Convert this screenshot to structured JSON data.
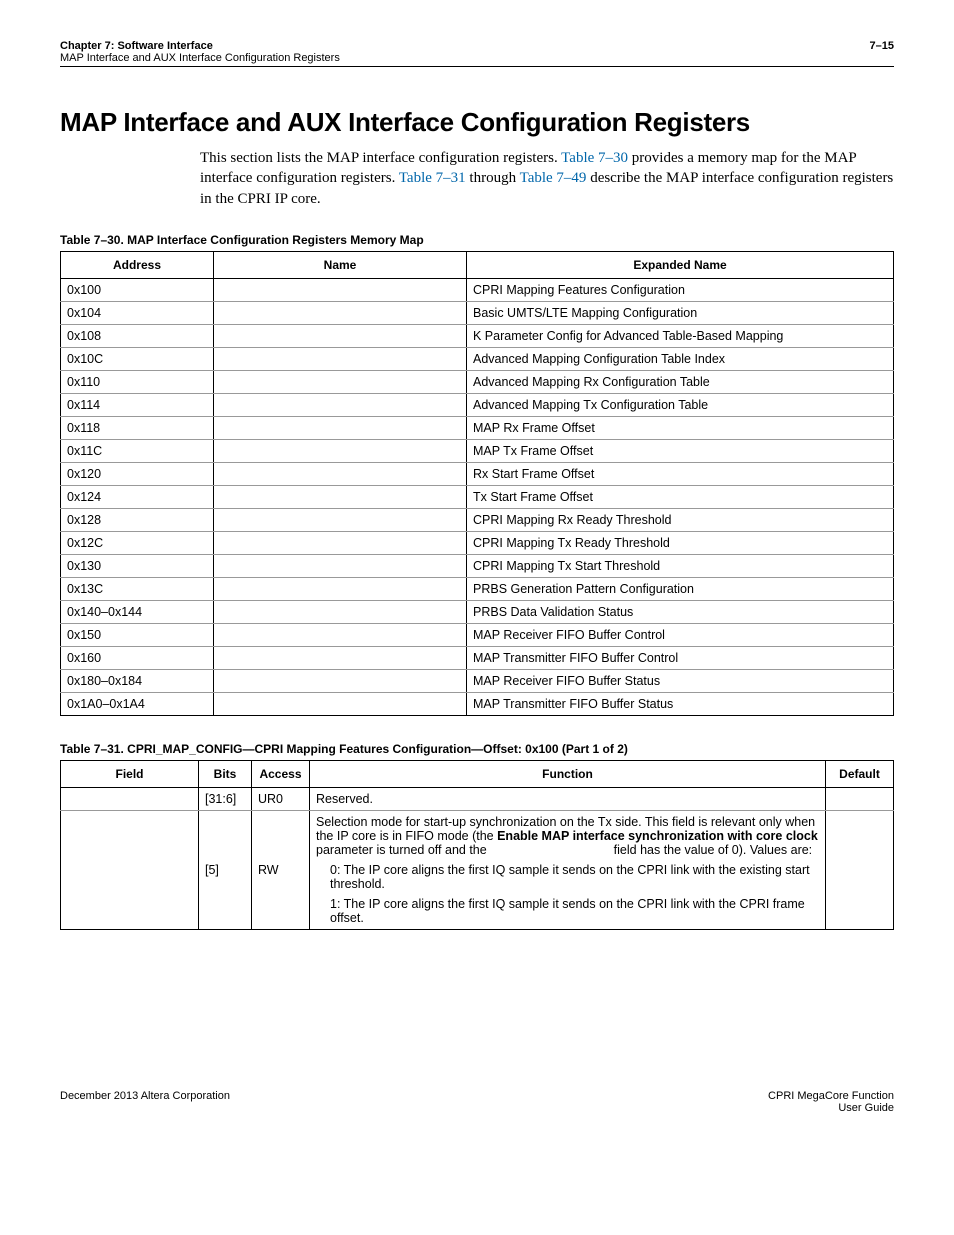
{
  "header": {
    "chapter": "Chapter 7:  Software Interface",
    "section": "MAP Interface and AUX Interface Configuration Registers",
    "page": "7–15"
  },
  "title": "MAP Interface and AUX Interface Configuration Registers",
  "intro": {
    "t1": "This section lists the MAP interface configuration registers. ",
    "link1": "Table 7–30",
    "t2": " provides a memory map for the MAP interface configuration registers. ",
    "link2": "Table 7–31",
    "t3": " through ",
    "link3": "Table 7–49",
    "t4": " describe the MAP interface configuration registers in the CPRI IP core."
  },
  "table30": {
    "caption": "Table 7–30.  MAP Interface Configuration Registers Memory Map",
    "headers": [
      "Address",
      "Name",
      "Expanded Name"
    ],
    "rows": [
      {
        "addr": "0x100",
        "name": "",
        "exp": "CPRI Mapping Features Configuration"
      },
      {
        "addr": "0x104",
        "name": "",
        "exp": "Basic UMTS/LTE Mapping Configuration"
      },
      {
        "addr": "0x108",
        "name": "",
        "exp": "K Parameter Config for Advanced Table-Based Mapping"
      },
      {
        "addr": "0x10C",
        "name": "",
        "exp": "Advanced Mapping Configuration Table Index"
      },
      {
        "addr": "0x110",
        "name": "",
        "exp": "Advanced Mapping Rx Configuration Table"
      },
      {
        "addr": "0x114",
        "name": "",
        "exp": "Advanced Mapping Tx Configuration Table"
      },
      {
        "addr": "0x118",
        "name": "",
        "exp": "MAP Rx Frame Offset"
      },
      {
        "addr": "0x11C",
        "name": "",
        "exp": "MAP Tx Frame Offset"
      },
      {
        "addr": "0x120",
        "name": "",
        "exp": "Rx Start Frame Offset"
      },
      {
        "addr": "0x124",
        "name": "",
        "exp": "Tx Start Frame Offset"
      },
      {
        "addr": "0x128",
        "name": "",
        "exp": "CPRI Mapping Rx Ready Threshold"
      },
      {
        "addr": "0x12C",
        "name": "",
        "exp": "CPRI Mapping Tx Ready Threshold"
      },
      {
        "addr": "0x130",
        "name": "",
        "exp": "CPRI Mapping Tx Start Threshold"
      },
      {
        "addr": "0x13C",
        "name": "",
        "exp": "PRBS Generation Pattern Configuration"
      },
      {
        "addr": "0x140–0x144",
        "name": "",
        "exp": "PRBS Data Validation Status"
      },
      {
        "addr": "0x150",
        "name": "",
        "exp": "MAP Receiver FIFO Buffer Control"
      },
      {
        "addr": "0x160",
        "name": "",
        "exp": "MAP Transmitter FIFO Buffer Control"
      },
      {
        "addr": "0x180–0x184",
        "name": "",
        "exp": "MAP Receiver FIFO Buffer Status"
      },
      {
        "addr": "0x1A0–0x1A4",
        "name": "",
        "exp": "MAP Transmitter FIFO Buffer Status"
      }
    ]
  },
  "table31": {
    "caption": "Table 7–31.  CPRI_MAP_CONFIG—CPRI Mapping Features Configuration—Offset: 0x100  (Part 1 of 2)",
    "headers": [
      "Field",
      "Bits",
      "Access",
      "Function",
      "Default"
    ],
    "row1": {
      "field": "",
      "bits": "[31:6]",
      "access": "UR0",
      "function": "Reserved.",
      "default": ""
    },
    "row2": {
      "field": "",
      "bits": "[5]",
      "access": "RW",
      "func_p1a": "Selection mode for start-up synchronization on the Tx side. This field is relevant only when the IP core is in FIFO mode (the ",
      "func_p1b": "Enable MAP interface synchronization with core clock",
      "func_p1c": " parameter is turned off and the ",
      "func_p1d": " field has the value of 0). Values are:",
      "func_v0": "0: The IP core aligns the first IQ sample it sends on the CPRI link with the existing start threshold.",
      "func_v1": "1: The IP core aligns the first IQ sample it sends on the CPRI link with the CPRI frame offset.",
      "default": ""
    }
  },
  "footer": {
    "left": "December 2013   Altera Corporation",
    "right1": "CPRI MegaCore Function",
    "right2": "User Guide"
  }
}
